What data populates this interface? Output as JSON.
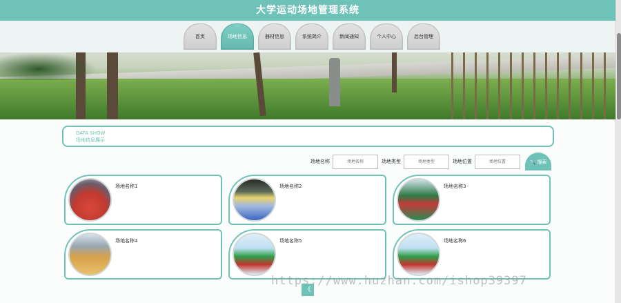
{
  "header": {
    "title": "大学运动场地管理系统"
  },
  "nav": {
    "items": [
      {
        "label": "首页"
      },
      {
        "label": "场地信息"
      },
      {
        "label": "器材信息"
      },
      {
        "label": "系统简介"
      },
      {
        "label": "新闻通知"
      },
      {
        "label": "个人中心"
      },
      {
        "label": "后台管理"
      }
    ]
  },
  "section": {
    "title_en": "DATA SHOW",
    "title_zh": "场地信息展示"
  },
  "search": {
    "name_label": "场地名称",
    "name_placeholder": "场地名称",
    "type_label": "场地类型",
    "type_placeholder": "场地类型",
    "location_label": "场地位置",
    "location_placeholder": "场地位置",
    "button_label": "搜索"
  },
  "cards": [
    {
      "name": "场地名称1"
    },
    {
      "name": "场地名称2"
    },
    {
      "name": "场地名称3"
    },
    {
      "name": "场地名称4"
    },
    {
      "name": "场地名称5"
    },
    {
      "name": "场地名称6"
    }
  ],
  "watermark": "https://www.huzhan.com/ishop39397",
  "pagination": {
    "prev_glyph": "《"
  },
  "colors": {
    "accent": "#6fc2b8"
  }
}
